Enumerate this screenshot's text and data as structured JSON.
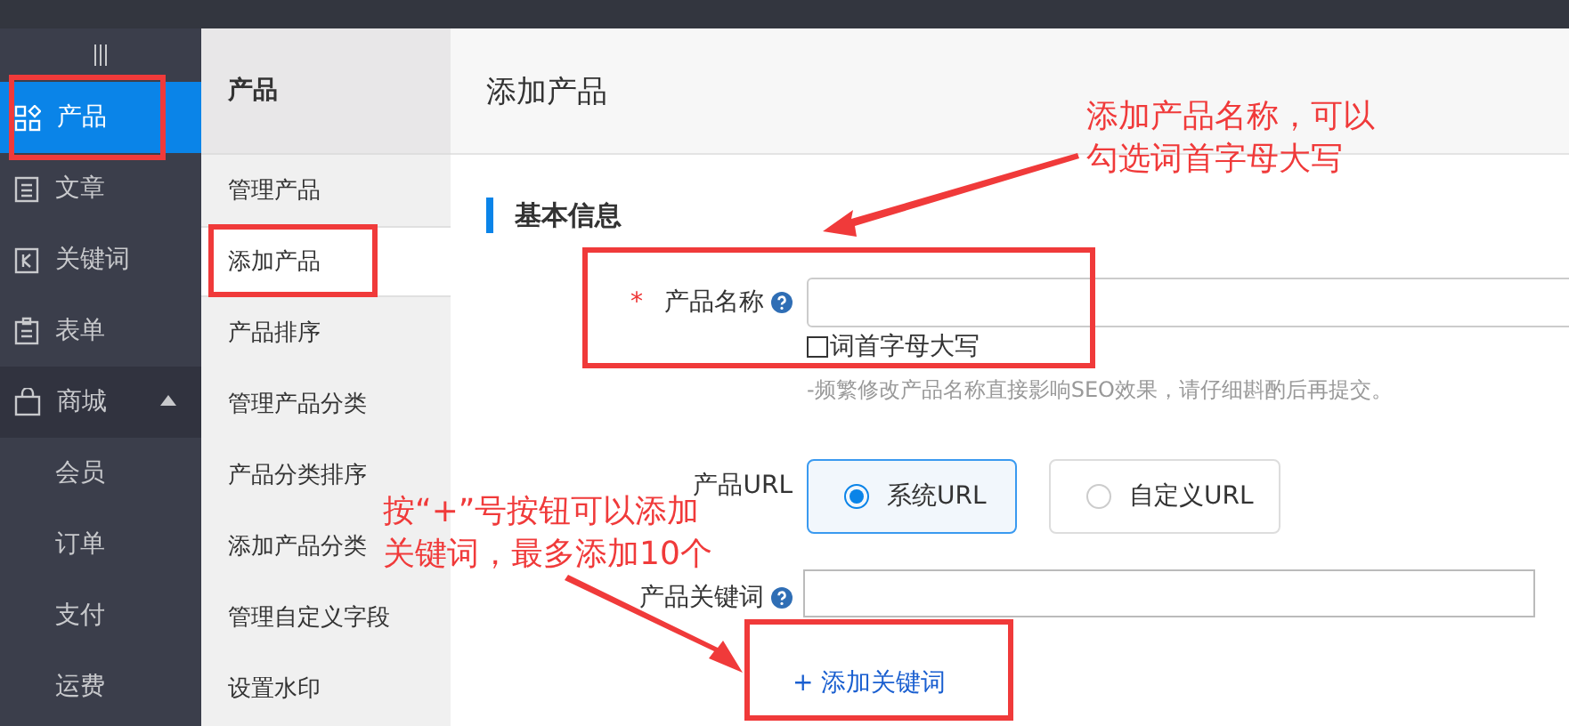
{
  "sidebar": {
    "items": [
      {
        "label": "产品",
        "selected": true
      },
      {
        "label": "文章",
        "selected": false
      },
      {
        "label": "关键词",
        "selected": false
      },
      {
        "label": "表单",
        "selected": false
      },
      {
        "label": "商城",
        "selected": false,
        "expanded": true,
        "children": [
          {
            "label": "会员",
            "selected": false
          },
          {
            "label": "订单",
            "selected": false
          },
          {
            "label": "支付",
            "selected": false
          },
          {
            "label": "运费",
            "selected": false
          }
        ]
      }
    ]
  },
  "submenu": {
    "title": "产品",
    "items": [
      {
        "label": "管理产品",
        "selected": false
      },
      {
        "label": "添加产品",
        "selected": true
      },
      {
        "label": "产品排序",
        "selected": false
      },
      {
        "label": "管理产品分类",
        "selected": false
      },
      {
        "label": "产品分类排序",
        "selected": false
      },
      {
        "label": "添加产品分类",
        "selected": false
      },
      {
        "label": "管理自定义字段",
        "selected": false
      },
      {
        "label": "设置水印",
        "selected": false
      }
    ]
  },
  "page_title": "添加产品",
  "section_title": "基本信息",
  "product_name": {
    "label": "产品名称",
    "required_mark": "*",
    "checkbox": {
      "label": "词首字母大写",
      "checked": false
    },
    "hint": "-频繁修改产品名称直接影响SEO效果，请仔细斟酌后再提交。"
  },
  "product_url": {
    "label": "产品URL",
    "options": [
      {
        "label": "系统URL",
        "selected": true
      },
      {
        "label": "自定义URL",
        "selected": false
      }
    ]
  },
  "product_keywords": {
    "label": "产品关键词",
    "add_link": "+ 添加关键词"
  },
  "annotations": {
    "notes": [
      "添加产品名称，可以",
      "勾选词首字母大写",
      "按“+”号按钮可以添加",
      "关键词，最多添加10个"
    ]
  }
}
